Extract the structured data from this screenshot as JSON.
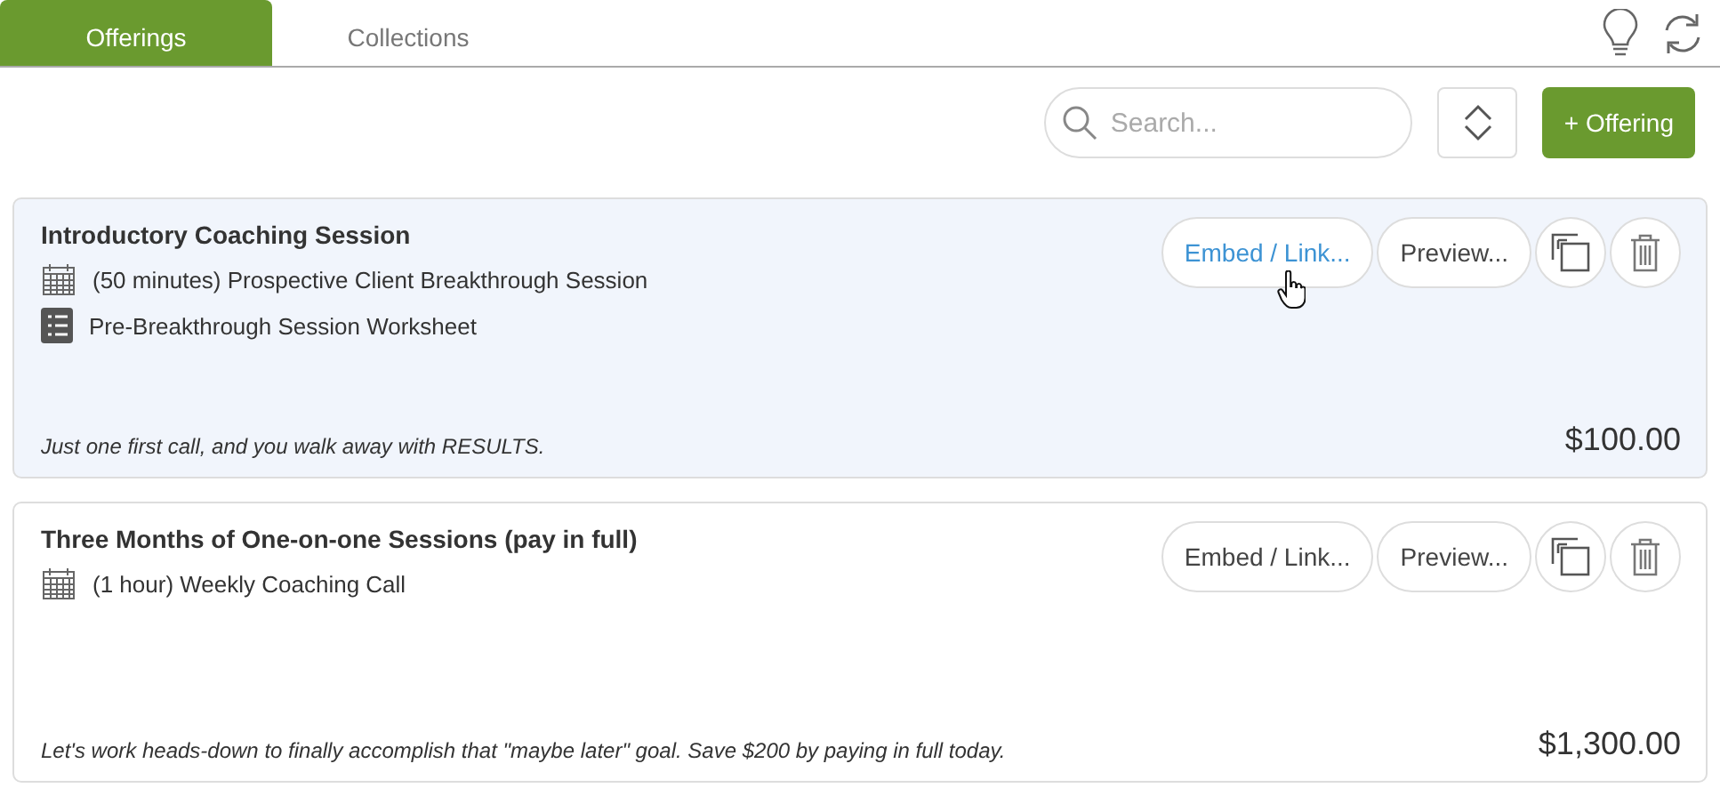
{
  "tabs": [
    {
      "label": "Offerings",
      "selected": true
    },
    {
      "label": "Collections",
      "selected": false
    }
  ],
  "search": {
    "placeholder": "Search..."
  },
  "add_button": "+ Offering",
  "offerings": [
    {
      "title": "Introductory Coaching Session",
      "hovered": true,
      "items": [
        {
          "kind": "session",
          "label": "(50 minutes) Prospective Client Breakthrough Session"
        },
        {
          "kind": "worksheet",
          "label": "Pre-Breakthrough Session Worksheet"
        }
      ],
      "description": "Just one first call, and you walk away with RESULTS.",
      "price": "$100.00",
      "embed_button": "Embed / Link...",
      "preview_button": "Preview..."
    },
    {
      "title": "Three Months of One-on-one Sessions (pay in full)",
      "hovered": false,
      "items": [
        {
          "kind": "session",
          "label": "(1 hour) Weekly Coaching Call"
        }
      ],
      "description": "Let's work heads-down to finally accomplish that \"maybe later\" goal. Save $200 by paying in full today.",
      "price": "$1,300.00",
      "embed_button": "Embed / Link...",
      "preview_button": "Preview..."
    }
  ]
}
